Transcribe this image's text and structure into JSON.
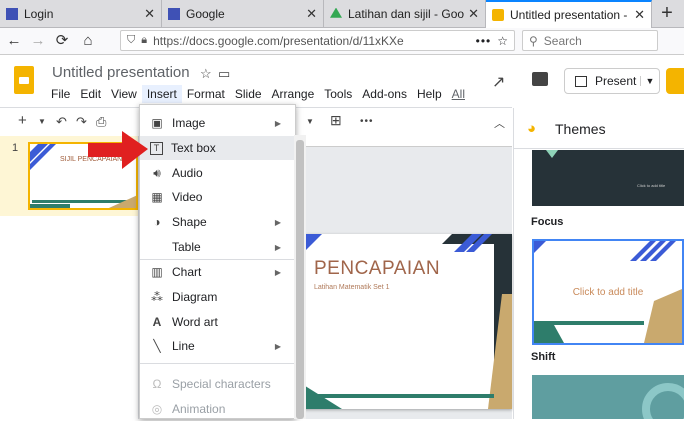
{
  "browser": {
    "tabs": [
      {
        "label": "Login",
        "color": "#3f51b5"
      },
      {
        "label": "Google",
        "color": "#3f51b5"
      },
      {
        "label": "Latihan dan sijil - Google Dri",
        "color": "#34a853"
      },
      {
        "label": "Untitled presentation - Goo",
        "color": "#f4b400",
        "active": true
      }
    ],
    "url": "https://docs.google.com/presentation/d/11xKXe",
    "search_placeholder": "Search"
  },
  "app": {
    "title": "Untitled presentation",
    "menus": [
      "File",
      "Edit",
      "View",
      "Insert",
      "Format",
      "Slide",
      "Arrange",
      "Tools",
      "Add-ons",
      "Help",
      "All"
    ],
    "open_menu": "Insert",
    "present_label": "Present"
  },
  "filmstrip": {
    "slide_number": "1",
    "thumb_title": "SIJIL PENCAPAIAN"
  },
  "slide": {
    "title": "PENCAPAIAN",
    "subtitle": "Latihan Matematik Set 1"
  },
  "themes": {
    "header": "Themes",
    "items": [
      {
        "name": "Focus",
        "placeholder": "Click to add title"
      },
      {
        "name": "Shift",
        "placeholder": "Click to add title"
      }
    ]
  },
  "insert_menu": {
    "items": [
      {
        "label": "Image",
        "icon": "image-icon",
        "submenu": true
      },
      {
        "label": "Text box",
        "icon": "text-box-icon",
        "hover": true
      },
      {
        "label": "Audio",
        "icon": "audio-icon"
      },
      {
        "label": "Video",
        "icon": "video-icon"
      },
      {
        "label": "Shape",
        "icon": "shape-icon",
        "submenu": true
      },
      {
        "label": "Table",
        "icon": "",
        "submenu": true
      },
      {
        "label": "Chart",
        "icon": "chart-icon",
        "submenu": true
      },
      {
        "label": "Diagram",
        "icon": "diagram-icon"
      },
      {
        "label": "Word art",
        "icon": "word-art-icon"
      },
      {
        "label": "Line",
        "icon": "line-icon",
        "submenu": true
      },
      {
        "label": "Special characters",
        "icon": "omega-icon",
        "disabled": true
      },
      {
        "label": "Animation",
        "icon": "animation-icon",
        "disabled": true
      }
    ]
  },
  "annotation": {
    "arrow_color": "#e02020"
  }
}
